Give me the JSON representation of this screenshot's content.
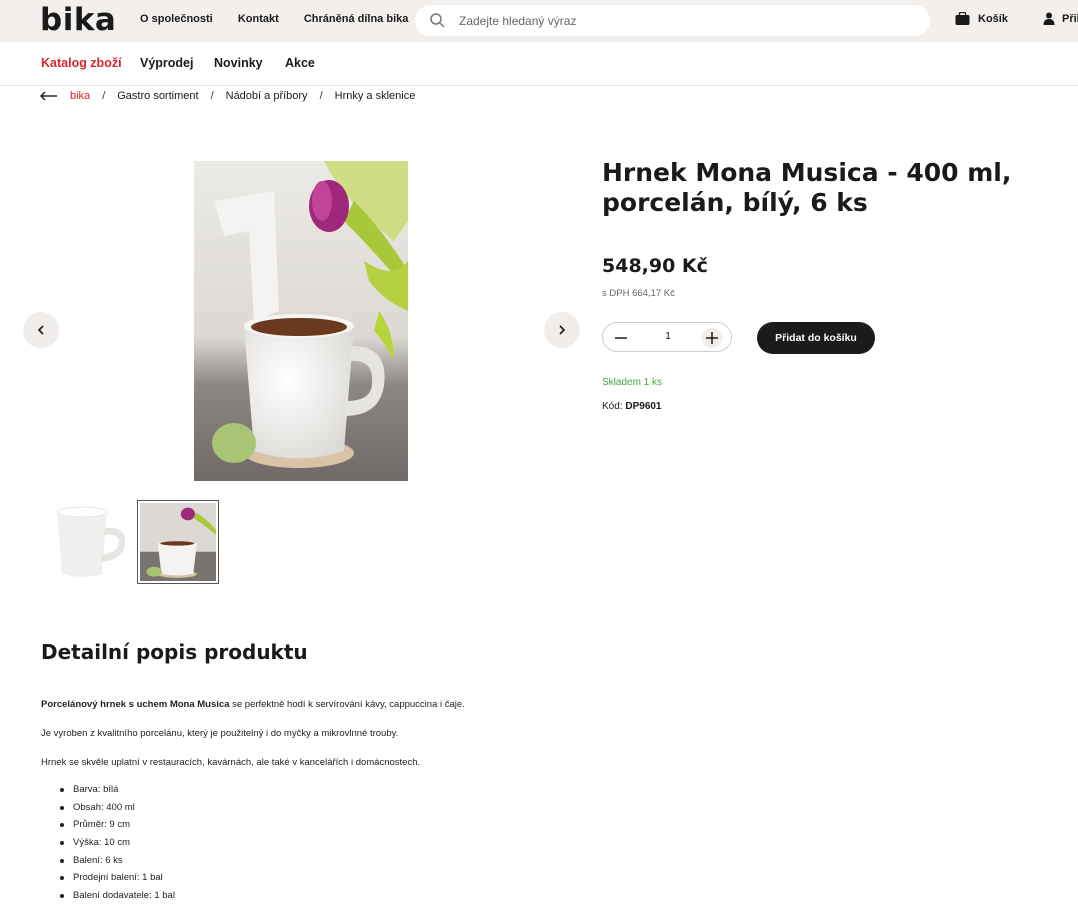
{
  "header": {
    "logo": "bika",
    "links": [
      "O společnosti",
      "Kontakt",
      "Chráněná dílna bika"
    ],
    "search_placeholder": "Zadejte hledaný výraz",
    "cart_label": "Košík",
    "login_label": "Přil"
  },
  "nav": {
    "items": [
      "Katalog zboží",
      "Výprodej",
      "Novinky",
      "Akce"
    ],
    "active": "Katalog zboží"
  },
  "breadcrumb": [
    "bika",
    "Gastro sortiment",
    "Nádobí a příbory",
    "Hrnky a sklenice"
  ],
  "product": {
    "title": "Hrnek Mona Musica - 400 ml, porcelán, bílý, 6 ks",
    "price": "548,90 Kč",
    "vat_price": "s DPH 664,17 Kč",
    "quantity": "1",
    "add_to_cart": "Přidat do košíku",
    "stock": "Skladem 1 ks",
    "code_label": "Kód:",
    "code": "DP9601"
  },
  "description": {
    "title": "Detailní popis produktu",
    "intro_bold": "Porcelánový hrnek s uchem Mona Musica",
    "intro_rest": " se perfektně hodí k servírování kávy, cappuccina i čaje.",
    "p2": "Je vyroben z kvalitního porcelánu, který je použitelný i do myčky a mikrovlnné trouby.",
    "p3": "Hrnek se skvěle uplatní v restauracích, kavárnách, ale také v kancelářích i domácnostech.",
    "specs": [
      "Barva: bílá",
      "Obsah: 400 ml",
      "Průměr: 9 cm",
      "Výška: 10 cm",
      "Balení: 6 ks",
      "Prodejní balení: 1 bal",
      "Balení dodavatele: 1 bal"
    ]
  },
  "colors": {
    "accent": "#d9262e",
    "stock": "#3faa3f",
    "button": "#1b1b1b",
    "topbar": "#f2efed"
  }
}
